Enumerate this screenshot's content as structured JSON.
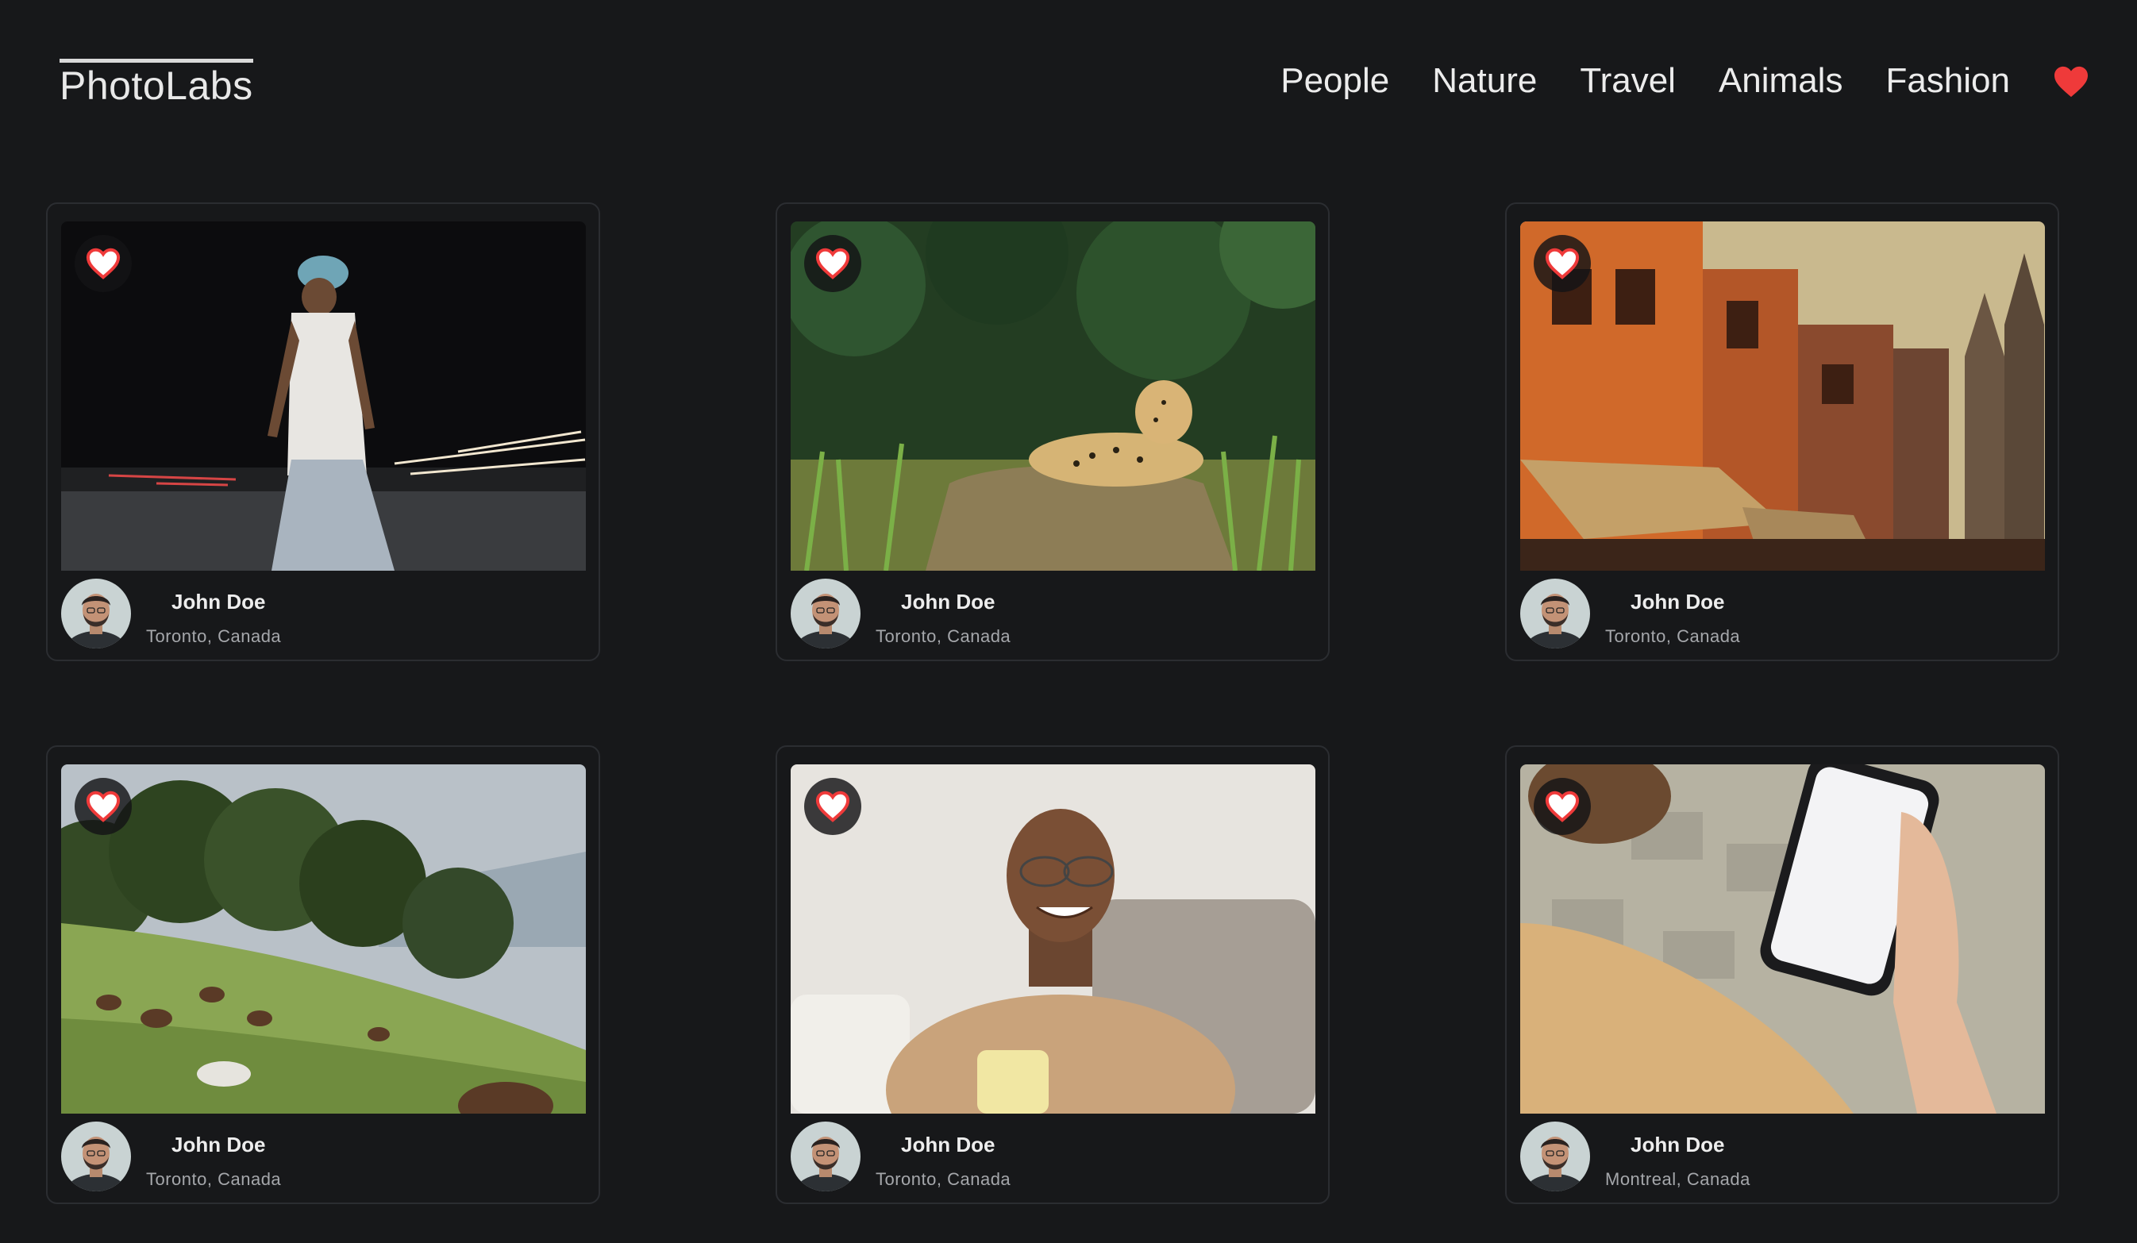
{
  "app": {
    "title": "PhotoLabs"
  },
  "nav": {
    "items": [
      {
        "label": "People"
      },
      {
        "label": "Nature"
      },
      {
        "label": "Travel"
      },
      {
        "label": "Animals"
      },
      {
        "label": "Fashion"
      }
    ],
    "favorites_icon": "heart-icon"
  },
  "colors": {
    "background": "#17181a",
    "accent_heart": "#ef3a3a",
    "card_border": "#2b2d31",
    "secondary_text": "#a5a7ab"
  },
  "photos": [
    {
      "subject": "man-walking-night-street",
      "user": {
        "name": "John Doe",
        "location": "Toronto, Canada"
      }
    },
    {
      "subject": "leopard-in-grass",
      "user": {
        "name": "John Doe",
        "location": "Toronto, Canada"
      }
    },
    {
      "subject": "orange-buildings-street",
      "user": {
        "name": "John Doe",
        "location": "Toronto, Canada"
      }
    },
    {
      "subject": "horses-grazing-hillside",
      "user": {
        "name": "John Doe",
        "location": "Toronto, Canada"
      }
    },
    {
      "subject": "smiling-man-with-mug",
      "user": {
        "name": "John Doe",
        "location": "Toronto, Canada"
      }
    },
    {
      "subject": "hand-holding-phone",
      "user": {
        "name": "John Doe",
        "location": "Montreal, Canada"
      }
    }
  ]
}
